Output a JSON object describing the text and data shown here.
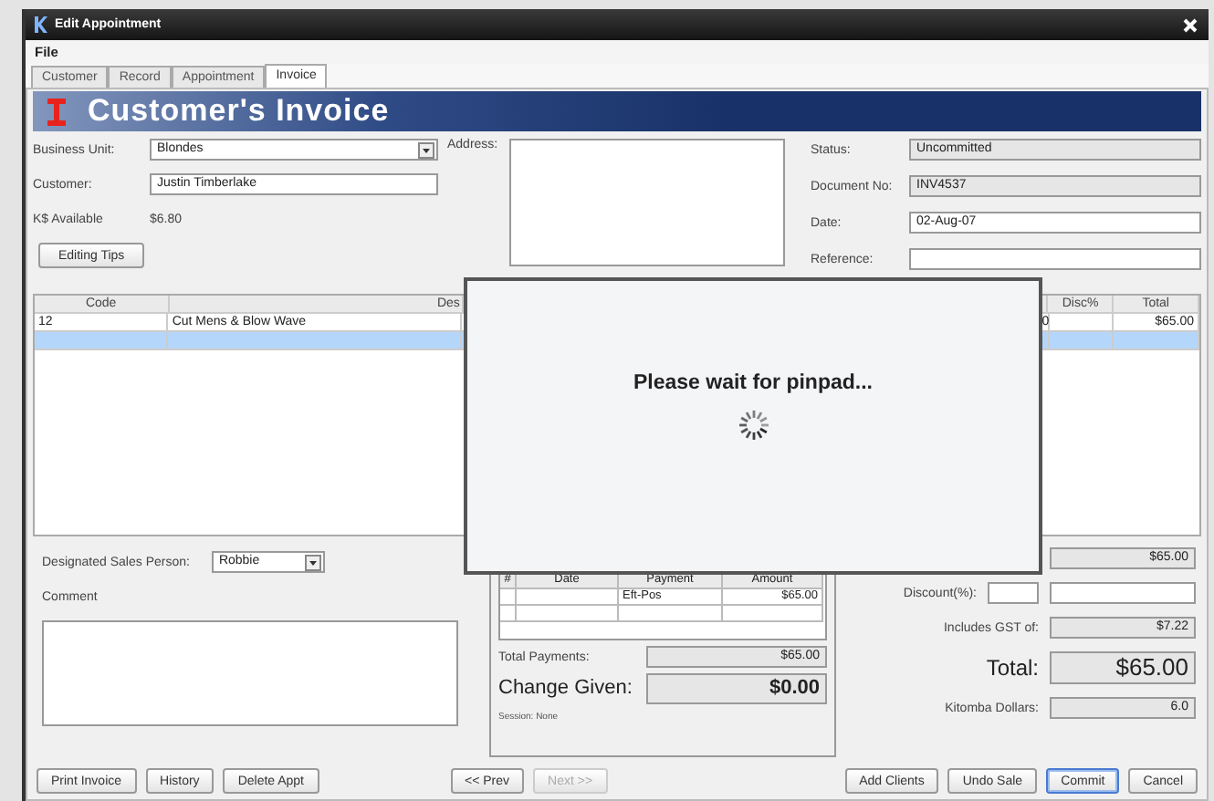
{
  "window": {
    "title": "Edit Appointment"
  },
  "menu": [
    "File"
  ],
  "tabs": [
    {
      "label": "Customer",
      "selected": false
    },
    {
      "label": "Record",
      "selected": false
    },
    {
      "label": "Appointment",
      "selected": false
    },
    {
      "label": "Invoice",
      "selected": true
    }
  ],
  "banner": {
    "title": "Customer's Invoice"
  },
  "form": {
    "business_unit": {
      "label": "Business Unit:",
      "value": "Blondes"
    },
    "customer": {
      "label": "Customer:",
      "value": "Justin Timberlake"
    },
    "ks_available": {
      "label": "K$ Available",
      "value": "$6.80"
    },
    "editing_tips_button": "Editing Tips",
    "address": {
      "label": "Address:"
    },
    "status": {
      "label": "Status:",
      "value": "Uncommitted"
    },
    "document_no": {
      "label": "Document No:",
      "value": "INV4537"
    },
    "date": {
      "label": "Date:",
      "value": "02-Aug-07"
    },
    "reference": {
      "label": "Reference:"
    }
  },
  "items_table": {
    "columns": [
      "Code",
      "Des",
      "Disc%",
      "Total"
    ],
    "rows": [
      {
        "code": "12",
        "description": "Cut Mens & Blow Wave",
        "column_3": "0",
        "total": "$65.00",
        "selected": false
      },
      {
        "selected": true
      }
    ]
  },
  "sales_person": {
    "label": "Designated Sales Person:",
    "value": "Robbie"
  },
  "comment": {
    "label": "Comment"
  },
  "payments": {
    "columns": [
      "#",
      "Date",
      "Payment",
      "Amount"
    ],
    "rows": [
      {
        "payment": "Eft-Pos",
        "amount": "$65.00"
      }
    ],
    "total_payments": {
      "label": "Total Payments:",
      "value": "$65.00"
    },
    "change_given": {
      "label": "Change Given:",
      "value": "$0.00"
    },
    "session": "Session: None"
  },
  "totals": {
    "subtotal": "$65.00",
    "discount": {
      "label": "Discount(%):"
    },
    "gst": {
      "label": "Includes GST of:",
      "value": "$7.22"
    },
    "total": {
      "label": "Total:",
      "value": "$65.00"
    },
    "kitomba": {
      "label": "Kitomba Dollars:",
      "value": "6.0"
    }
  },
  "buttons_left": [
    "Print Invoice",
    "History",
    "Delete Appt"
  ],
  "nav_buttons": [
    {
      "label": "<< Prev",
      "disabled": false
    },
    {
      "label": "Next >>",
      "disabled": true
    }
  ],
  "buttons_right": [
    {
      "label": "Add Clients",
      "focused": false
    },
    {
      "label": "Undo Sale",
      "focused": false
    },
    {
      "label": "Commit",
      "focused": true
    },
    {
      "label": "Cancel",
      "focused": false
    }
  ],
  "dialog": {
    "message": "Please wait for pinpad..."
  }
}
